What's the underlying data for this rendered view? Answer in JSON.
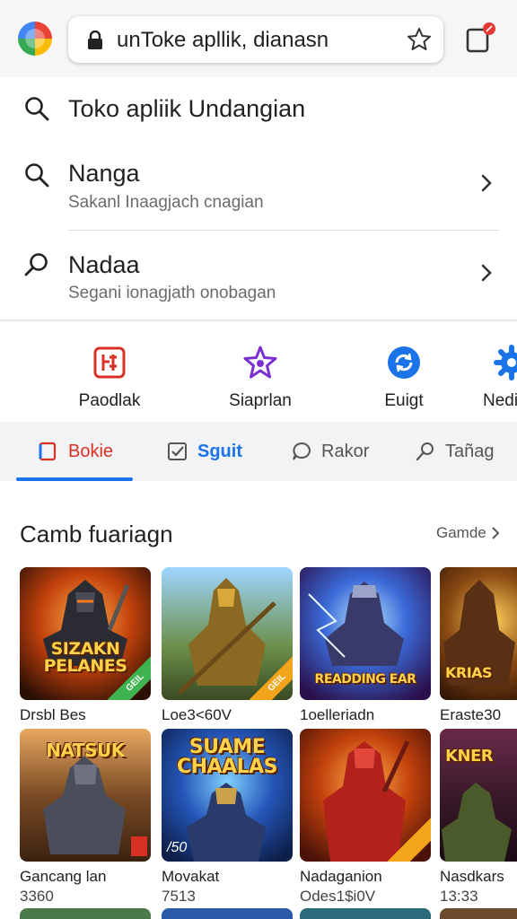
{
  "browser": {
    "url_text": "unToke apllik, dianasn"
  },
  "suggestions": [
    {
      "title": "Toko apliik Undangian",
      "subtitle": "",
      "icon": "search-icon"
    },
    {
      "title": "Nanga",
      "subtitle": "Sakanl Inaagjach cnagian",
      "icon": "search-icon"
    },
    {
      "title": "Nadaa",
      "subtitle": "Segani ionagjath onobagan",
      "icon": "history-icon"
    }
  ],
  "shortcuts": [
    {
      "label": "Paodlak",
      "icon": "red-app-icon"
    },
    {
      "label": "Siaprlan",
      "icon": "purple-star-icon"
    },
    {
      "label": "Euigt",
      "icon": "blue-sync-icon"
    },
    {
      "label": "Nedi",
      "icon": "gear-icon"
    }
  ],
  "category_tabs": [
    {
      "label": "Bokie",
      "icon": "bookmark-icon",
      "active": true
    },
    {
      "label": "Sguit",
      "icon": "checkbox-icon",
      "active": false
    },
    {
      "label": "Rakor",
      "icon": "chat-icon",
      "active": false
    },
    {
      "label": "Tañag",
      "icon": "pin-icon",
      "active": false
    }
  ],
  "section": {
    "title": "Camb fuariagn",
    "more_label": "Gamde"
  },
  "games_row1": [
    {
      "name": "Drsbl Bes",
      "sub": "",
      "art_title": "SIZAKN PELANES",
      "badge": "GEIL"
    },
    {
      "name": "Loe3<60V",
      "sub": "",
      "art_title": "",
      "badge": "GEIL"
    },
    {
      "name": "1oelleriadn",
      "sub": "",
      "art_title": "READDING EAR",
      "badge": ""
    },
    {
      "name": "Eraste30",
      "sub": "",
      "art_title": "KRIAS",
      "badge": ""
    }
  ],
  "games_row2": [
    {
      "name": "Gancang lan",
      "sub": "3360",
      "art_title": "NATSUK",
      "badge": ""
    },
    {
      "name": "Movakat",
      "sub": "7513",
      "art_title": "SUAME CHAALAS",
      "badge": ""
    },
    {
      "name": "Nadaganion",
      "sub": "Odes1$i0V",
      "art_title": "",
      "badge": ""
    },
    {
      "name": "Nasdkars",
      "sub": "13:33",
      "art_title": "KNER",
      "badge": ""
    }
  ],
  "row2_overlay_text": "/50",
  "colors": {
    "accent": "#1a73e8",
    "active_tab": "#d93025",
    "notification_dot": "#e53935"
  }
}
